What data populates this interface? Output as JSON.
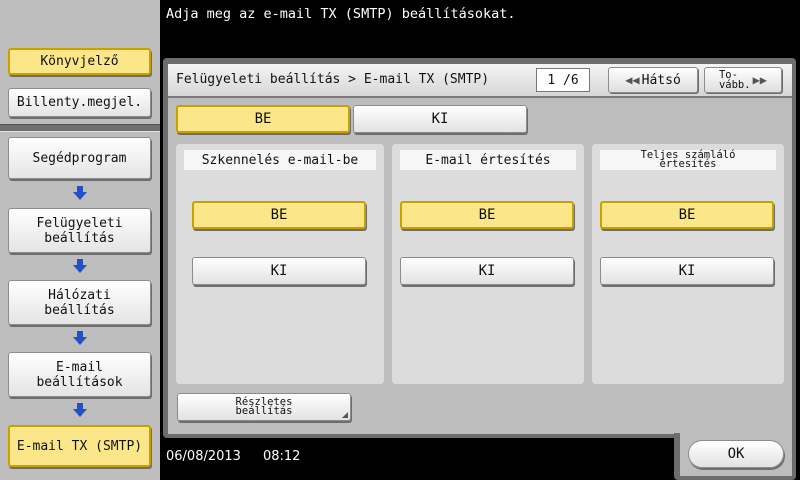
{
  "message": "Adja meg az e-mail TX (SMTP) beállításokat.",
  "sidebar": {
    "bookmark": "Könyvjelző",
    "keyboard": "Billenty.megjel.",
    "breadcrumb": [
      "Segédprogram",
      "Felügyeleti\nbeállítás",
      "Hálózati\nbeállítás",
      "E-mail\nbeállítások",
      "E-mail TX (SMTP)"
    ]
  },
  "header": {
    "title": "Felügyeleti beállítás > E-mail TX (SMTP)",
    "page": "1 /6",
    "back_label": "Hátsó",
    "next_label": "To-\nvább."
  },
  "main_toggle": {
    "on_label": "BE",
    "off_label": "KI",
    "selected": "BE"
  },
  "columns": [
    {
      "title": "Szkennelés e-mail-be",
      "on_label": "BE",
      "off_label": "KI",
      "selected": "BE"
    },
    {
      "title": "E-mail értesítés",
      "on_label": "BE",
      "off_label": "KI",
      "selected": "BE"
    },
    {
      "title": "Teljes számláló\nértesítés",
      "on_label": "BE",
      "off_label": "KI",
      "selected": "BE"
    }
  ],
  "details_label": "Részletes\nbeállítás",
  "ok_label": "OK",
  "status": {
    "date": "06/08/2013",
    "time": "08:12"
  },
  "colors": {
    "selected": "#fbe78a",
    "selected_border": "#c7a100",
    "panel": "#bdbdbd"
  }
}
